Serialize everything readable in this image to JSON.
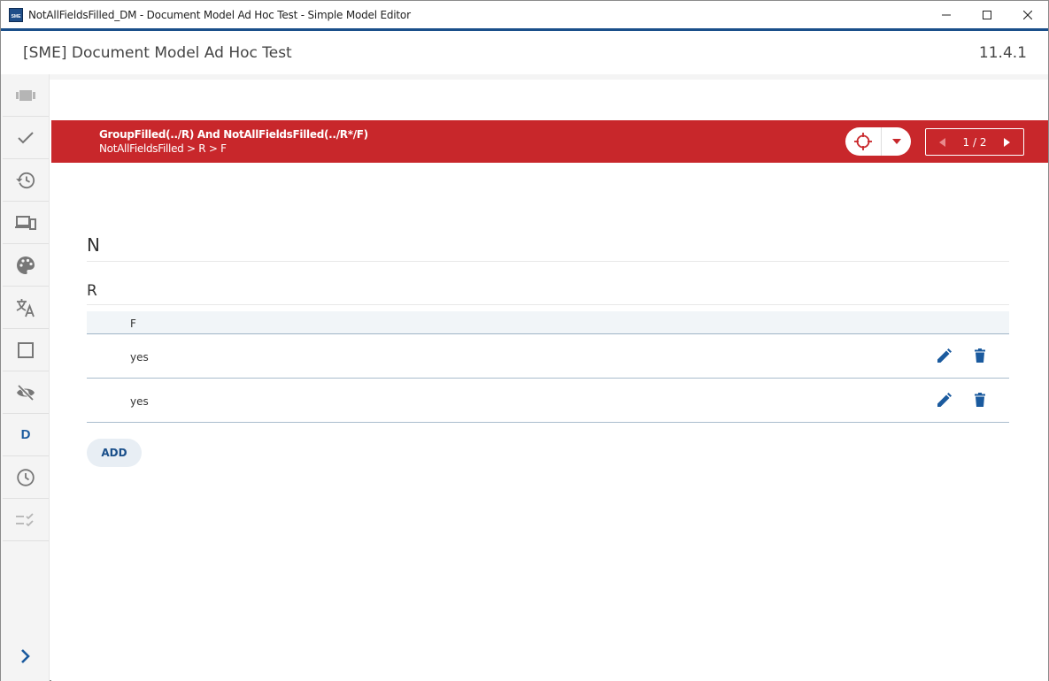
{
  "window": {
    "title": "NotAllFieldsFilled_DM - Document Model Ad Hoc Test - Simple Model Editor",
    "app_icon_text": "SME"
  },
  "header": {
    "title": "[SME] Document Model Ad Hoc Test",
    "version": "11.4.1"
  },
  "sidebar": {
    "items": [
      {
        "icon": "model-tree-icon"
      },
      {
        "icon": "check-icon"
      },
      {
        "icon": "history-icon"
      },
      {
        "icon": "devices-icon"
      },
      {
        "icon": "palette-icon"
      },
      {
        "icon": "translate-icon"
      },
      {
        "icon": "square-icon"
      },
      {
        "icon": "visibility-off-icon"
      },
      {
        "icon": "d-letter-icon",
        "label": "D"
      },
      {
        "icon": "clock-icon"
      },
      {
        "icon": "checklist-icon"
      }
    ],
    "expand_icon": "chevron-right-icon"
  },
  "banner": {
    "title": "GroupFilled(../R) And NotAllFieldsFilled(../R*/F)",
    "path": "NotAllFieldsFilled > R > F",
    "pager": "1 / 2",
    "color": "#c8272b"
  },
  "content": {
    "section_n": "N",
    "section_r": "R",
    "table": {
      "columns": [
        "F"
      ],
      "rows": [
        {
          "F": "yes"
        },
        {
          "F": "yes"
        }
      ]
    },
    "add_label": "ADD"
  },
  "colors": {
    "accent": "#1a4f8a",
    "icon_blue": "#1a5a9e",
    "sidebar_icon": "#777777"
  }
}
